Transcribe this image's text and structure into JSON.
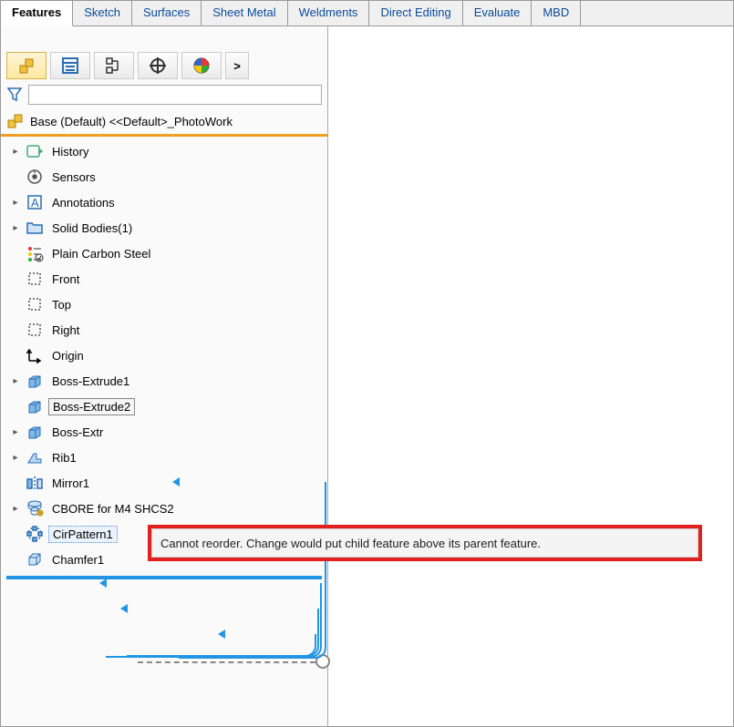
{
  "tabs": {
    "items": [
      "Features",
      "Sketch",
      "Surfaces",
      "Sheet Metal",
      "Weldments",
      "Direct Editing",
      "Evaluate",
      "MBD"
    ],
    "active": 0
  },
  "panel": {
    "filter_placeholder": "",
    "root_label": "Base (Default) <<Default>_PhotoWork",
    "tree": [
      {
        "icon": "history-icon",
        "label": "History",
        "expander": true
      },
      {
        "icon": "sensor-icon",
        "label": "Sensors",
        "expander": false
      },
      {
        "icon": "annotation-icon",
        "label": "Annotations",
        "expander": true
      },
      {
        "icon": "folder-icon",
        "label": "Solid Bodies(1)",
        "expander": true
      },
      {
        "icon": "material-icon",
        "label": "Plain Carbon Steel",
        "expander": false
      },
      {
        "icon": "plane-icon",
        "label": "Front",
        "expander": false
      },
      {
        "icon": "plane-icon",
        "label": "Top",
        "expander": false
      },
      {
        "icon": "plane-icon",
        "label": "Right",
        "expander": false
      },
      {
        "icon": "origin-icon",
        "label": "Origin",
        "expander": false
      },
      {
        "icon": "extrude-icon",
        "label": "Boss-Extrude1",
        "expander": true,
        "arrow": true
      },
      {
        "icon": "extrude-icon",
        "label": "Boss-Extrude2",
        "expander": false,
        "highlight": true
      },
      {
        "icon": "extrude-icon",
        "label": "Boss-Extr",
        "expander": true,
        "truncated": true
      },
      {
        "icon": "rib-icon",
        "label": "Rib1",
        "expander": true,
        "arrow": true
      },
      {
        "icon": "mirror-icon",
        "label": "Mirror1",
        "expander": false,
        "arrow": true
      },
      {
        "icon": "hole-icon",
        "label": "CBORE for M4 SHCS2",
        "expander": true,
        "arrow": true
      },
      {
        "icon": "circpattern-icon",
        "label": "CirPattern1",
        "expander": false,
        "selected": true,
        "dragline": true
      },
      {
        "icon": "chamfer-icon",
        "label": "Chamfer1",
        "expander": false
      }
    ]
  },
  "tooltip": {
    "text": "Cannot reorder. Change would put child feature above its parent feature."
  }
}
